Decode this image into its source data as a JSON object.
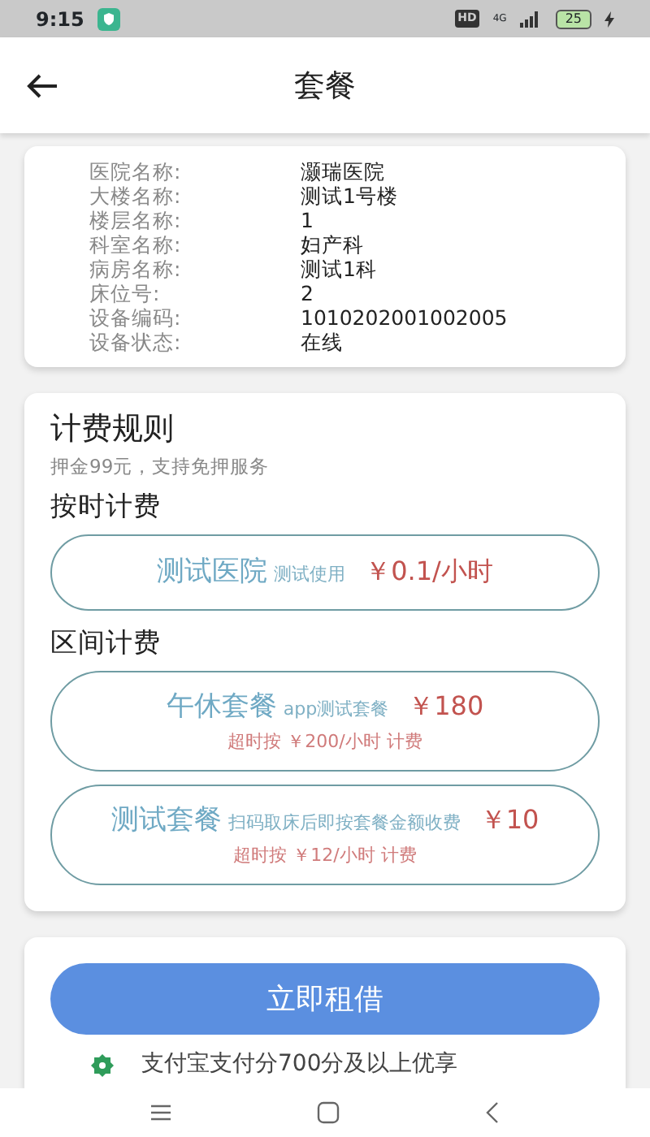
{
  "status_bar": {
    "time": "9:15",
    "hd": "HD",
    "network": "4G",
    "battery": "25"
  },
  "header": {
    "title": "套餐"
  },
  "device_info": [
    {
      "label": "医院名称:",
      "value": "灏瑞医院"
    },
    {
      "label": "大楼名称:",
      "value": "测试1号楼"
    },
    {
      "label": "楼层名称:",
      "value": "1"
    },
    {
      "label": "科室名称:",
      "value": "妇产科"
    },
    {
      "label": "病房名称:",
      "value": "测试1科"
    },
    {
      "label": "床位号:",
      "value": "2"
    },
    {
      "label": "设备编码:",
      "value": "1010202001002005"
    },
    {
      "label": "设备状态:",
      "value": "在线"
    }
  ],
  "billing": {
    "title": "计费规则",
    "deposit_note": "押金99元，支持免押服务",
    "sections": [
      {
        "heading": "按时计费",
        "plans": [
          {
            "name": "测试医院",
            "desc": "测试使用",
            "price": "￥0.1/小时"
          }
        ]
      },
      {
        "heading": "区间计费",
        "plans": [
          {
            "name": "午休套餐",
            "desc": "app测试套餐",
            "price": "￥180",
            "overtime": "超时按 ￥200/小时 计费"
          },
          {
            "name": "测试套餐",
            "desc": "扫码取床后即按套餐金额收费",
            "price": "￥10",
            "overtime": "超时按 ￥12/小时 计费"
          }
        ]
      }
    ]
  },
  "rent_button": "立即租借",
  "notice": "支付宝支付分700分及以上优享"
}
